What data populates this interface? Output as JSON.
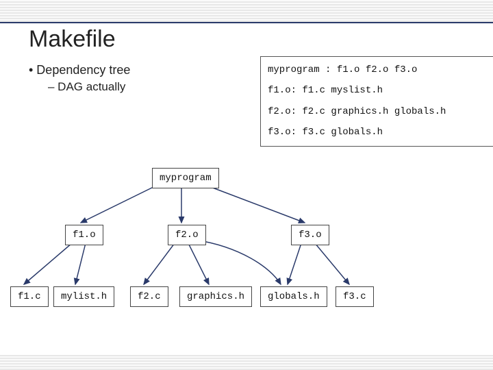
{
  "title": "Makefile",
  "bullets": {
    "b1": "• Dependency tree",
    "b2": "–  DAG actually"
  },
  "code": {
    "l1": "myprogram : f1.o f2.o f3.o",
    "l2": "f1.o: f1.c myslist.h",
    "l3": "f2.o: f2.c graphics.h globals.h",
    "l4": "f3.o: f3.c globals.h"
  },
  "nodes": {
    "myprogram": "myprogram",
    "f1o": "f1.o",
    "f2o": "f2.o",
    "f3o": "f3.o",
    "f1c": "f1.c",
    "mylist": "mylist.h",
    "f2c": "f2.c",
    "graphics": "graphics.h",
    "globals": "globals.h",
    "f3c": "f3.c"
  }
}
